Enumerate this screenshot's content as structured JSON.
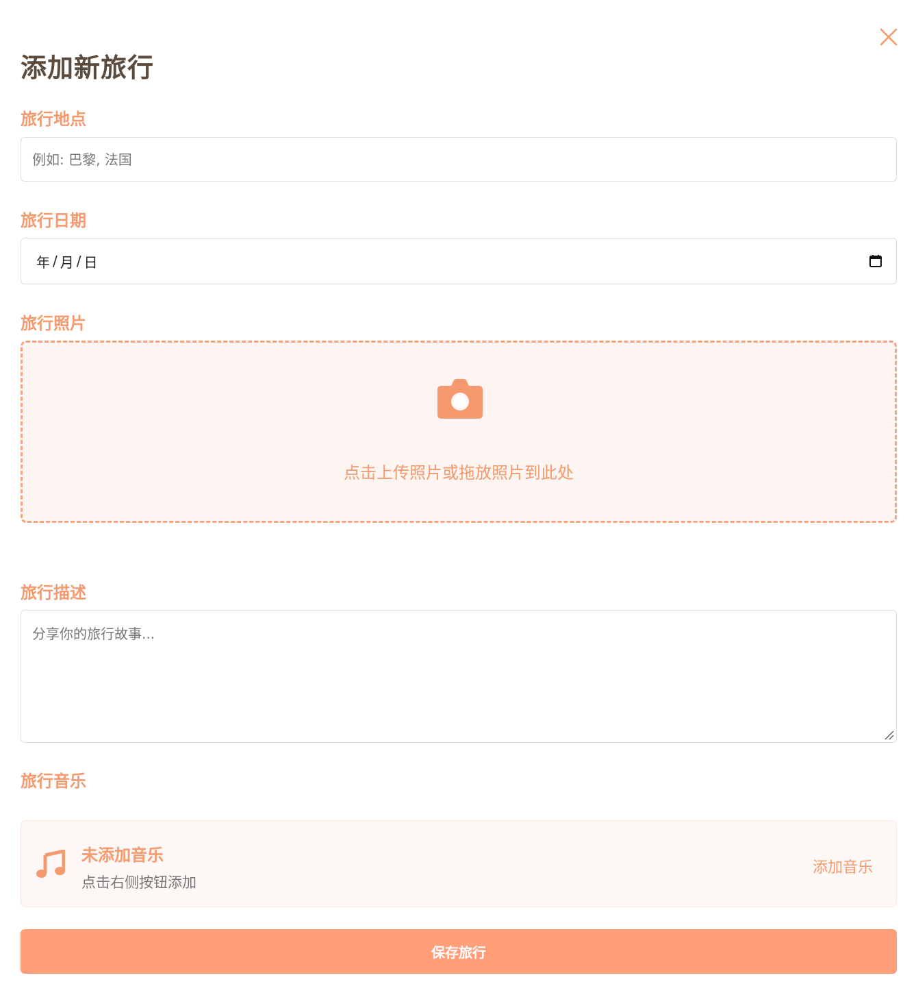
{
  "modal": {
    "title": "添加新旅行",
    "close_icon": "close-icon"
  },
  "location": {
    "label": "旅行地点",
    "placeholder": "例如: 巴黎, 法国",
    "value": ""
  },
  "date": {
    "label": "旅行日期",
    "year": "年",
    "month": "月",
    "day": "日",
    "sep": "/",
    "icon": "calendar-icon"
  },
  "photo": {
    "label": "旅行照片",
    "icon": "camera-icon",
    "prompt": "点击上传照片或拖放照片到此处"
  },
  "description": {
    "label": "旅行描述",
    "placeholder": "分享你的旅行故事...",
    "value": ""
  },
  "music": {
    "label": "旅行音乐",
    "icon": "music-note-icon",
    "status": "未添加音乐",
    "hint": "点击右侧按钮添加",
    "add_label": "添加音乐"
  },
  "save_label": "保存旅行",
  "colors": {
    "accent": "#f5996f",
    "button": "#ff9e78",
    "title": "#5b4a3e",
    "upload_bg": "#fdf5f1"
  }
}
